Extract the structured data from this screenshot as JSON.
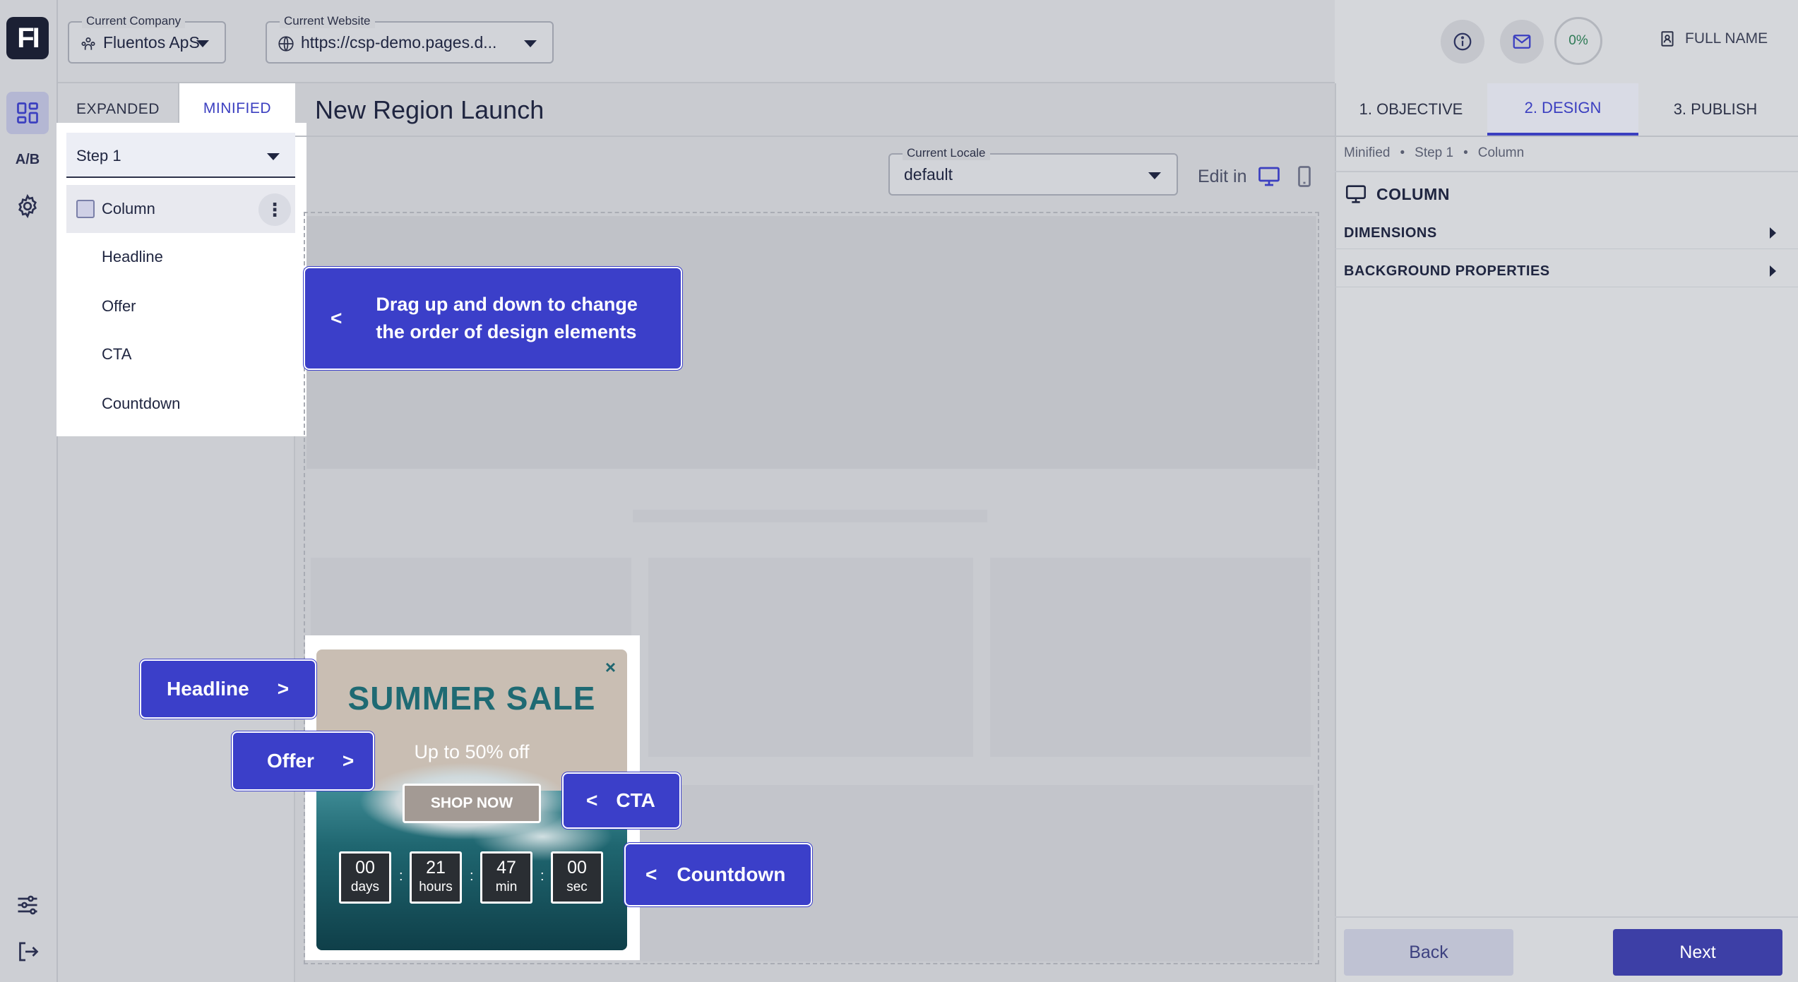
{
  "header": {
    "logo": "FI",
    "company": {
      "label": "Current Company",
      "value": "Fluentos ApS"
    },
    "website": {
      "label": "Current Website",
      "value": "https://csp-demo.pages.d..."
    },
    "progress": "0%",
    "user": "FULL NAME"
  },
  "rail": {
    "ab_label": "A/B"
  },
  "left_panel": {
    "tabs": [
      {
        "label": "EXPANDED"
      },
      {
        "label": "MINIFIED"
      }
    ],
    "step_select": "Step 1",
    "tree": [
      {
        "label": "Column"
      },
      {
        "label": "Headline"
      },
      {
        "label": "Offer"
      },
      {
        "label": "CTA"
      },
      {
        "label": "Countdown"
      }
    ]
  },
  "editor": {
    "title": "New Region Launch",
    "locale": {
      "label": "Current Locale",
      "value": "default"
    },
    "edit_in": "Edit in"
  },
  "popup": {
    "close": "×",
    "headline": "SUMMER SALE",
    "offer": "Up to 50% off",
    "cta": "SHOP NOW",
    "countdown": [
      {
        "value": "00",
        "unit": "days"
      },
      {
        "value": "21",
        "unit": "hours"
      },
      {
        "value": "47",
        "unit": "min"
      },
      {
        "value": "00",
        "unit": "sec"
      }
    ],
    "separator": ":"
  },
  "callouts": {
    "drag": {
      "arrow": "<",
      "text_line1": "Drag up and down to change",
      "text_line2": "the order of design elements"
    },
    "headline": {
      "text": "Headline",
      "arrow": ">"
    },
    "offer": {
      "text": "Offer",
      "arrow": ">"
    },
    "cta": {
      "text": "CTA",
      "arrow": "<"
    },
    "countdown": {
      "text": "Countdown",
      "arrow": "<"
    }
  },
  "right_panel": {
    "tabs": [
      {
        "label": "1. OBJECTIVE"
      },
      {
        "label": "2. DESIGN"
      },
      {
        "label": "3. PUBLISH"
      }
    ],
    "breadcrumb": [
      "Minified",
      "Step 1",
      "Column"
    ],
    "breadcrumb_sep": "•",
    "section_title": "COLUMN",
    "accordions": [
      {
        "label": "DIMENSIONS"
      },
      {
        "label": "BACKGROUND PROPERTIES"
      }
    ],
    "back": "Back",
    "next": "Next"
  },
  "colors": {
    "accent": "#3b3fc9",
    "headline_teal": "#1e6a73",
    "next_button": "#3d3fa6"
  }
}
